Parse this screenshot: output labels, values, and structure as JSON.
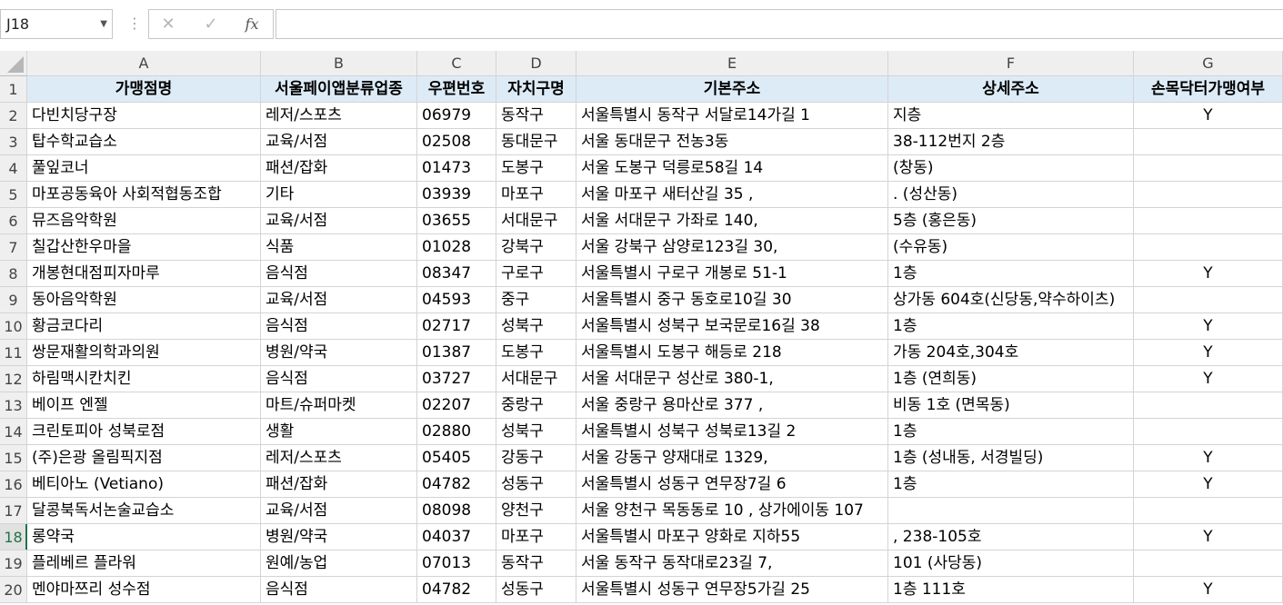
{
  "name_box": {
    "value": "J18"
  },
  "formula_bar": {
    "cancel_icon": "close-icon",
    "enter_icon": "check-icon",
    "fx_label": "fx",
    "value": ""
  },
  "columns": [
    "A",
    "B",
    "C",
    "D",
    "E",
    "F",
    "G"
  ],
  "selected_row": "18",
  "header_row": [
    "가맹점명",
    "서울페이앱분류업종",
    "우편번호",
    "자치구명",
    "기본주소",
    "상세주소",
    "손목닥터가맹여부"
  ],
  "rows": [
    {
      "n": "2",
      "c": [
        "다빈치당구장",
        "레저/스포츠",
        "06979",
        "동작구",
        "서울특별시 동작구 서달로14가길 1",
        "지층",
        "Y"
      ]
    },
    {
      "n": "3",
      "c": [
        "탑수학교습소",
        "교육/서점",
        "02508",
        "동대문구",
        "서울  동대문구  전농3동",
        "38-112번지  2층",
        ""
      ]
    },
    {
      "n": "4",
      "c": [
        "풀잎코너",
        "패션/잡화",
        "01473",
        "도봉구",
        "서울 도봉구 덕릉로58길 14",
        "(창동)",
        ""
      ]
    },
    {
      "n": "5",
      "c": [
        "마포공동육아 사회적협동조합",
        "기타",
        "03939",
        "마포구",
        "서울 마포구 새터산길 35 ,",
        ". (성산동)",
        ""
      ]
    },
    {
      "n": "6",
      "c": [
        "뮤즈음악학원",
        "교육/서점",
        "03655",
        "서대문구",
        "서울 서대문구 가좌로 140,",
        "5층 (홍은동)",
        ""
      ]
    },
    {
      "n": "7",
      "c": [
        "칠갑산한우마을",
        "식품",
        "01028",
        "강북구",
        "서울 강북구 삼양로123길 30,",
        "(수유동)",
        ""
      ]
    },
    {
      "n": "8",
      "c": [
        "개봉현대점피자마루",
        "음식점",
        "08347",
        "구로구",
        "서울특별시 구로구 개봉로 51-1",
        "1층",
        "Y"
      ]
    },
    {
      "n": "9",
      "c": [
        "동아음악학원",
        "교육/서점",
        "04593",
        "중구",
        "서울특별시 중구 동호로10길 30",
        "상가동 604호(신당동,약수하이츠)",
        ""
      ]
    },
    {
      "n": "10",
      "c": [
        "황금코다리",
        "음식점",
        "02717",
        "성북구",
        "서울특별시 성북구 보국문로16길 38",
        "1층",
        "Y"
      ]
    },
    {
      "n": "11",
      "c": [
        "쌍문재활의학과의원",
        "병원/약국",
        "01387",
        "도봉구",
        "서울특별시 도봉구 해등로 218",
        "가동 204호,304호",
        "Y"
      ]
    },
    {
      "n": "12",
      "c": [
        "하림맥시칸치킨",
        "음식점",
        "03727",
        "서대문구",
        "서울 서대문구 성산로 380-1,",
        "1층 (연희동)",
        "Y"
      ]
    },
    {
      "n": "13",
      "c": [
        "베이프 엔젤",
        "마트/슈퍼마켓",
        "02207",
        "중랑구",
        "서울 중랑구 용마산로 377 ,",
        "비동 1호 (면목동)",
        ""
      ]
    },
    {
      "n": "14",
      "c": [
        "크린토피아 성북로점",
        "생활",
        "02880",
        "성북구",
        "서울특별시 성북구 성북로13길 2",
        "1층",
        ""
      ]
    },
    {
      "n": "15",
      "c": [
        "(주)은광 올림픽지점",
        "레저/스포츠",
        "05405",
        "강동구",
        "서울 강동구 양재대로 1329,",
        "1층 (성내동, 서경빌딩)",
        "Y"
      ]
    },
    {
      "n": "16",
      "c": [
        "베티아노 (Vetiano)",
        "패션/잡화",
        "04782",
        "성동구",
        "서울특별시 성동구 연무장7길 6",
        "1층",
        "Y"
      ]
    },
    {
      "n": "17",
      "c": [
        "달콩북독서논술교습소",
        "교육/서점",
        "08098",
        "양천구",
        "서울 양천구 목동동로 10 , 상가에이동 107",
        "",
        ""
      ]
    },
    {
      "n": "18",
      "c": [
        "롱약국",
        "병원/약국",
        "04037",
        "마포구",
        "서울특별시 마포구 양화로 지하55",
        ", 238-105호",
        "Y"
      ]
    },
    {
      "n": "19",
      "c": [
        "플레베르 플라워",
        "원예/농업",
        "07013",
        "동작구",
        "서울 동작구 동작대로23길 7,",
        "101 (사당동)",
        ""
      ]
    },
    {
      "n": "20",
      "c": [
        "멘야마쯔리 성수점",
        "음식점",
        "04782",
        "성동구",
        "서울특별시 성동구 연무장5가길 25",
        "1층 111호",
        "Y"
      ]
    }
  ]
}
